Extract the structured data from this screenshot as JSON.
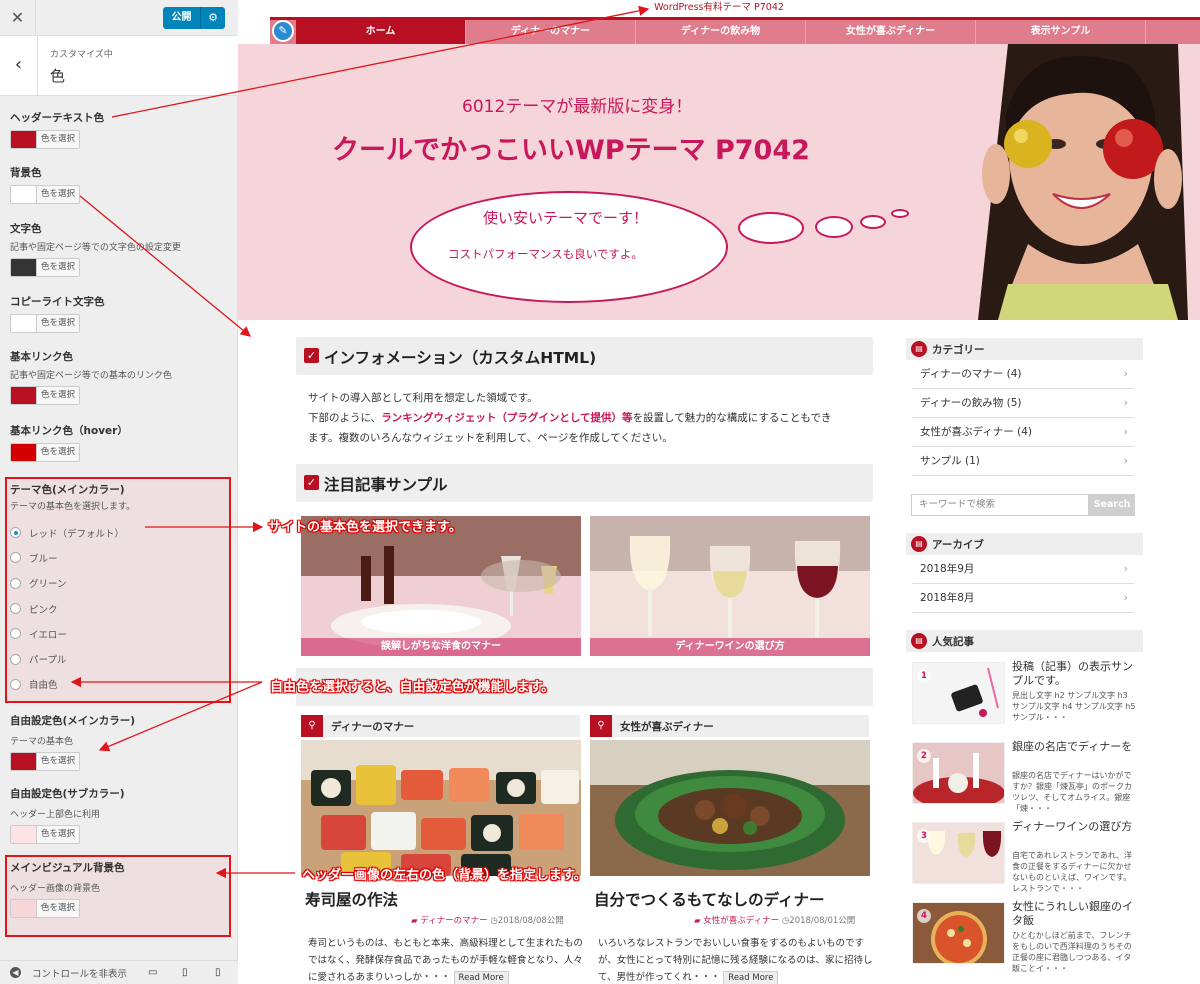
{
  "customizer": {
    "close_glyph": "✕",
    "publish_label": "公開",
    "gear_glyph": "⚙",
    "back_glyph": "‹",
    "breadcrumb": "カスタマイズ中",
    "section_title": "色",
    "picker_label": "色を選択",
    "controls": {
      "header_text": {
        "title": "ヘッダーテキスト色",
        "color": "#b80f22"
      },
      "background": {
        "title": "背景色",
        "color": "#ffffff"
      },
      "text": {
        "title": "文字色",
        "desc": "記事や固定ページ等での文字色の設定変更",
        "color": "#333333"
      },
      "copyright": {
        "title": "コピーライト文字色",
        "color": "#ffffff"
      },
      "link": {
        "title": "基本リンク色",
        "desc": "記事や固定ページ等での基本のリンク色",
        "color": "#b80f22"
      },
      "link_hover": {
        "title": "基本リンク色（hover）",
        "color": "#d40000"
      },
      "theme": {
        "title": "テーマ色(メインカラー)",
        "desc": "テーマの基本色を選択します。"
      },
      "free_main": {
        "title": "自由設定色(メインカラー)",
        "desc": "テーマの基本色",
        "color": "#b80f22"
      },
      "free_sub": {
        "title": "自由設定色(サブカラー)",
        "desc": "ヘッダー上部色に利用",
        "color": "#fde3e6"
      },
      "visual_bg": {
        "title": "メインビジュアル背景色",
        "desc": "ヘッダー画像の背景色",
        "color": "#f7d6da"
      }
    },
    "theme_options": [
      "レッド（デフォルト）",
      "ブルー",
      "グリーン",
      "ピンク",
      "イエロー",
      "パープル",
      "自由色"
    ],
    "footer_label": "コントロールを非表示"
  },
  "site": {
    "topbar_text": "WordPress有料テーマ P7042",
    "nav": [
      "ホーム",
      "ディナーのマナー",
      "ディナーの飲み物",
      "女性が喜ぶディナー",
      "表示サンプル"
    ],
    "hero": {
      "subtitle": "6012テーマが最新版に変身！",
      "title": "クールでかっこいいWPテーマ P7042",
      "bubble_line1": "使い安いテーマでーす！",
      "bubble_line2": "コストパフォーマンスも良いですよ。"
    },
    "info": {
      "heading": "インフォメーション（カスタムHTML)",
      "line1": "サイトの導入部として利用を想定した領域です。",
      "line2_pre": "下部のように、",
      "line2_red": "ランキングウィジェット（プラグインとして提供）等",
      "line2_post": "を設置して魅力的な構成にすることもでき",
      "line3": "ます。複数のいろんなウィジェットを利用して、ページを作成してください。"
    },
    "featured": {
      "heading": "注目記事サンプル",
      "items": [
        "誤解しがちな洋食のマナー",
        "ディナーワインの選び方"
      ]
    },
    "posts": [
      {
        "category": "ディナーのマナー",
        "title": "寿司屋の作法",
        "date": "2018/08/08公開",
        "excerpt": "寿司というものは、もともと本来、高級料理として生まれたものではなく、発酵保存食品であったものが手軽な軽食となり、人々に愛されるあまりいっしか・・・"
      },
      {
        "category": "女性が喜ぶディナー",
        "title": "自分でつくるもてなしのディナー",
        "date": "2018/08/01公開",
        "excerpt": "いろいろなレストランでおいしい食事をするのもよいものですが、女性にとって特別に記憶に残る経験になるのは、家に招待して、男性が作ってくれ・・・"
      }
    ],
    "read_more": "Read More",
    "sidebar": {
      "categories_title": "カテゴリー",
      "categories": [
        "ディナーのマナー (4)",
        "ディナーの飲み物 (5)",
        "女性が喜ぶディナー (4)",
        "サンプル (1)"
      ],
      "search_placeholder": "キーワードで検索",
      "search_button": "Search",
      "archives_title": "アーカイブ",
      "archives": [
        "2018年9月",
        "2018年8月"
      ],
      "popular_title": "人気記事",
      "popular": [
        {
          "rank": "1",
          "title": "投稿（記事）の表示サンプルです。",
          "excerpt": "見出し文字 h2 サンプル文字 h3 サンプル文字 h4 サンプル文字 h5 サンプル・・・"
        },
        {
          "rank": "2",
          "title": "銀座の名店でディナーを",
          "excerpt": "銀座の名店でディナーはいかがですか？銀座「煉瓦亭」のポークカツレツ、そしてオムライス。銀座「煉・・・"
        },
        {
          "rank": "3",
          "title": "ディナーワインの選び方",
          "excerpt": "自宅であれレストランであれ、洋食の正餐をするディナーに欠かせないものといえば、ワインです。レストランで・・・"
        },
        {
          "rank": "4",
          "title": "女性にうれしい銀座のイタ飯",
          "excerpt": "ひとむかしほど前まで、フレンチをもしのいで西洋料理のうちその正餐の座に君臨しつつある、イタ飯ことイ・・・"
        }
      ]
    }
  },
  "annotations": {
    "theme": "サイトの基本色を選択できます。",
    "free": "自由色を選択すると、自由設定色が機能します。",
    "visual": "ヘッダー画像の左右の色（背景）を指定します。"
  },
  "colors": {
    "accent": "#b80f22",
    "nav_pink": "#e07d8c",
    "hero_bg": "#f6d5da",
    "hero_text": "#c8175a",
    "publish_blue": "#0085ba",
    "annotation_red": "#e0151a"
  }
}
